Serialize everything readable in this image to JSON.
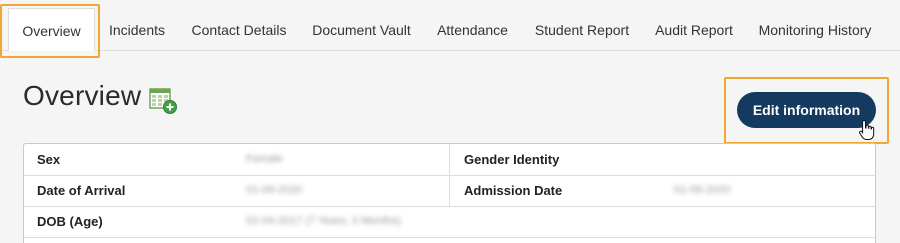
{
  "tabs": [
    {
      "label": "Overview",
      "active": true
    },
    {
      "label": "Incidents",
      "active": false
    },
    {
      "label": "Contact Details",
      "active": false
    },
    {
      "label": "Document Vault",
      "active": false
    },
    {
      "label": "Attendance",
      "active": false
    },
    {
      "label": "Student Report",
      "active": false
    },
    {
      "label": "Audit Report",
      "active": false
    },
    {
      "label": "Monitoring History",
      "active": false
    }
  ],
  "page": {
    "title": "Overview",
    "title_icon": "calendar-add-icon"
  },
  "actions": {
    "edit_label": "Edit information"
  },
  "details": {
    "sex_label": "Sex",
    "sex_value": "Female",
    "gender_identity_label": "Gender Identity",
    "gender_identity_value": "",
    "arrival_label": "Date of Arrival",
    "arrival_value": "01-09-2020",
    "admission_label": "Admission Date",
    "admission_value": "01-09-2020",
    "dob_label": "DOB (Age)",
    "dob_value": "02-04-2017 (7 Years, 3 Months)"
  },
  "colors": {
    "highlight": "#f0a830",
    "button_bg": "#143a60",
    "background": "#f5f5f5"
  }
}
